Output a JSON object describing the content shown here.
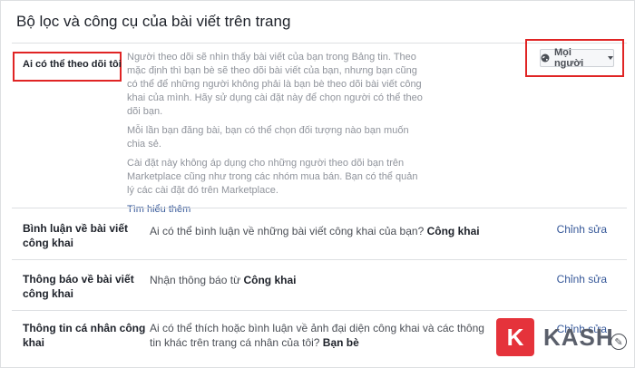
{
  "header": {
    "title": "Bộ lọc và công cụ của bài viết trên trang"
  },
  "followers": {
    "label": "Ai có thể theo dõi tôi",
    "paragraph1": "Người theo dõi sẽ nhìn thấy bài viết của bạn trong Bảng tin. Theo mặc định thì bạn bè sẽ theo dõi bài viết của bạn, nhưng bạn cũng có thể để những người không phải là bạn bè theo dõi bài viết công khai của mình. Hãy sử dụng cài đặt này để chọn người có thể theo dõi bạn.",
    "paragraph2": "Mỗi lần bạn đăng bài, bạn có thể chọn đối tượng nào bạn muốn chia sẻ.",
    "paragraph3": "Cài đặt này không áp dụng cho những người theo dõi bạn trên Marketplace cũng như trong các nhóm mua bán. Bạn có thể quản lý các cài đặt đó trên Marketplace.",
    "learn_more": "Tìm hiểu thêm",
    "audience_button": "Mọi người"
  },
  "rows": [
    {
      "label": "Bình luận về bài viết công khai",
      "desc_prefix": "Ai có thể bình luận về những bài viết công khai của bạn?",
      "desc_value": "Công khai",
      "edit": "Chỉnh sửa"
    },
    {
      "label": "Thông báo về bài viết công khai",
      "desc_prefix": "Nhận thông báo từ",
      "desc_value": "Công khai",
      "edit": "Chỉnh sửa"
    },
    {
      "label": "Thông tin cá nhân công khai",
      "desc_prefix": "Ai có thể thích hoặc bình luận về ảnh đại diện công khai và các thông tin khác trên trang cá nhân của tôi?",
      "desc_value": "Bạn bè",
      "edit": "Chỉnh sửa"
    }
  ],
  "watermark": {
    "badge": "K",
    "brand": "KASH"
  },
  "colors": {
    "link": "#365899",
    "highlight": "#e02424",
    "text": "#1d2129"
  }
}
